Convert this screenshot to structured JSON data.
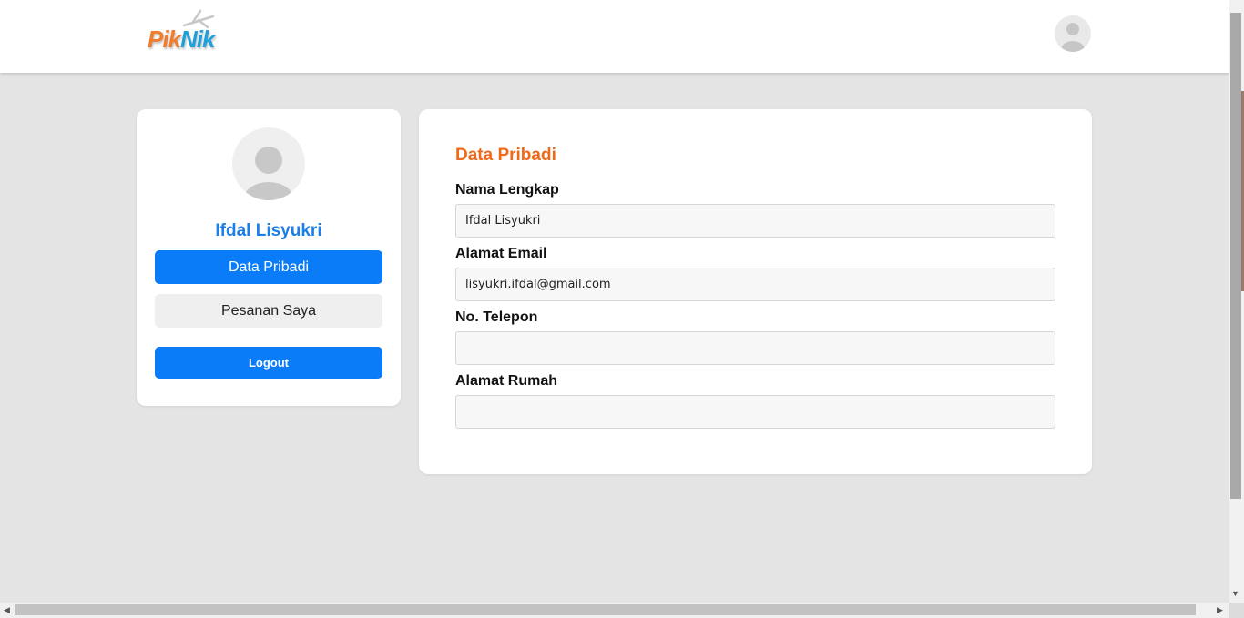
{
  "header": {
    "logo": {
      "part1": "Pik",
      "part2": "Nik"
    },
    "avatar_icon": "user-avatar-icon"
  },
  "sidebar": {
    "user_name": "Ifdal Lisyukri",
    "menu": [
      {
        "label": "Data Pribadi",
        "active": true
      },
      {
        "label": "Pesanan Saya",
        "active": false
      }
    ],
    "logout_label": "Logout"
  },
  "main": {
    "title": "Data Pribadi",
    "fields": [
      {
        "label": "Nama Lengkap",
        "value": "Ifdal Lisyukri"
      },
      {
        "label": "Alamat Email",
        "value": "lisyukri.ifdal@gmail.com"
      },
      {
        "label": "No. Telepon",
        "value": ""
      },
      {
        "label": "Alamat Rumah",
        "value": ""
      }
    ]
  },
  "colors": {
    "primary": "#0a7cf7",
    "accent_orange": "#ee6a1a",
    "name_blue": "#1a7fe6",
    "background": "#e4e4e4"
  }
}
